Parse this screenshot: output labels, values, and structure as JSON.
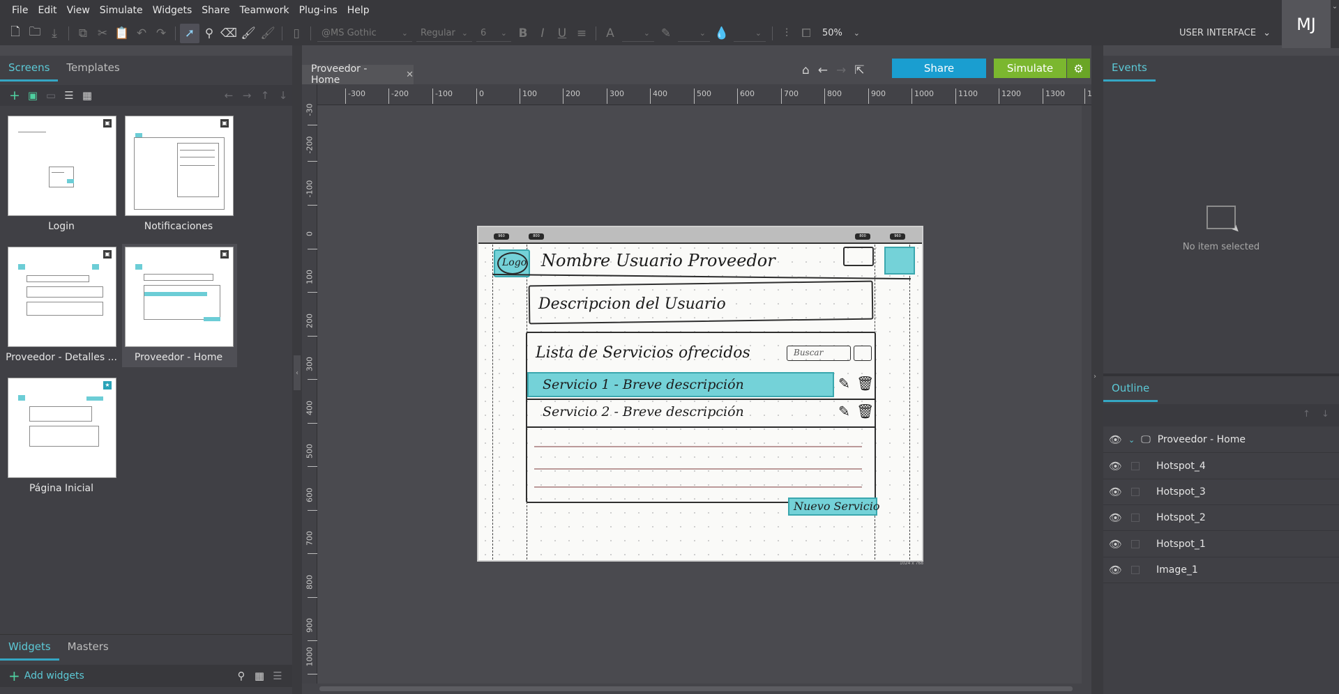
{
  "menu": [
    "File",
    "Edit",
    "View",
    "Simulate",
    "Widgets",
    "Share",
    "Teamwork",
    "Plug-ins",
    "Help"
  ],
  "toolbar": {
    "font_family": "@MS Gothic",
    "font_style": "Regular",
    "font_size": "6",
    "bold": "B",
    "italic": "I",
    "underline": "U",
    "font_color_glyph": "A",
    "zoom": "50%"
  },
  "ui_mode": "USER INTERFACE",
  "avatar_initials": "MJ",
  "left_tabs": {
    "screens": "Screens",
    "templates": "Templates"
  },
  "screens": [
    {
      "label": "Login"
    },
    {
      "label": "Notificaciones"
    },
    {
      "label": "Proveedor - Detalles ..."
    },
    {
      "label": "Proveedor - Home"
    },
    {
      "label": "Página Inicial"
    }
  ],
  "bottom_tabs": {
    "widgets": "Widgets",
    "masters": "Masters"
  },
  "add_widgets": "Add widgets",
  "document_tab": "Proveedor - Home",
  "buttons": {
    "share": "Share",
    "simulate": "Simulate"
  },
  "ruler_h": [
    "-300",
    "-200",
    "-100",
    "0",
    "100",
    "200",
    "300",
    "400",
    "500",
    "600",
    "700",
    "800",
    "900",
    "1000",
    "1100",
    "1200",
    "1300",
    "1"
  ],
  "ruler_v": [
    "-30",
    "-200",
    "-100",
    "0",
    "100",
    "200",
    "300",
    "400",
    "500",
    "600",
    "700",
    "800",
    "900",
    "1000"
  ],
  "sketch": {
    "logo": "Logo",
    "header": "Nombre Usuario Proveedor",
    "description": "Descripcion del Usuario",
    "list_title": "Lista de Servicios ofrecidos",
    "search": "Buscar",
    "service1": "Servicio 1 - Breve descripción",
    "service2": "Servicio 2 - Breve descripción",
    "new_service": "Nuevo Servicio",
    "pills": [
      "960",
      "800",
      "800",
      "960"
    ],
    "size_tag": "1024 x 768"
  },
  "right_panel": {
    "events_tab": "Events",
    "no_item": "No item selected",
    "outline_tab": "Outline",
    "outline": [
      {
        "label": "Proveedor - Home",
        "root": true
      },
      {
        "label": "Hotspot_4"
      },
      {
        "label": "Hotspot_3"
      },
      {
        "label": "Hotspot_2"
      },
      {
        "label": "Hotspot_1"
      },
      {
        "label": "Image_1"
      }
    ]
  },
  "colors": {
    "accent": "#35a7c4",
    "share": "#1a9ed0",
    "simulate": "#7bb72f",
    "panel": "#404045",
    "hotspot": "#74d2d8"
  }
}
